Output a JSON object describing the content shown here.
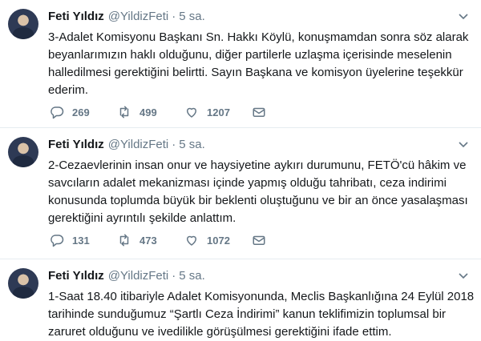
{
  "tweets": [
    {
      "name": "Feti Yıldız",
      "handle": "@YildizFeti",
      "separator": "·",
      "time": "5 sa.",
      "lines": [
        "3-Adalet Komisyonu Başkanı Sn. Hakkı Köylü, konuşmamdan sonra söz alarak",
        "beyanlarımızın haklı olduğunu, diğer partilerle uzlaşma içerisinde meselenin",
        "halledilmesi gerektiğini belirtti. Sayın Başkana ve komisyon üyelerine teşekkür",
        "ederim."
      ],
      "replies": "269",
      "retweets": "499",
      "likes": "1207"
    },
    {
      "name": "Feti Yıldız",
      "handle": "@YildizFeti",
      "separator": "·",
      "time": "5 sa.",
      "lines": [
        "2-Cezaevlerinin insan onur ve haysiyetine aykırı durumunu, FETÖ'cü hâkim ve",
        "savcıların adalet mekanizması içinde yapmış olduğu tahribatı, ceza indirimi",
        "konusunda toplumda büyük bir beklenti oluştuğunu ve bir an önce yasalaşması",
        "gerektiğini ayrıntılı şekilde anlattım."
      ],
      "replies": "131",
      "retweets": "473",
      "likes": "1072"
    },
    {
      "name": "Feti Yıldız",
      "handle": "@YildizFeti",
      "separator": "·",
      "time": "5 sa.",
      "lines": [
        "1-Saat 18.40 itibariyle Adalet Komisyonunda, Meclis Başkanlığına 24 Eylül 2018",
        "tarihinde sunduğumuz “Şartlı Ceza İndirimi” kanun teklifimizin toplumsal bir",
        "zaruret olduğunu ve ivedilikle görüşülmesi gerektiğini ifade ettim."
      ]
    }
  ],
  "icons": {
    "reply": "reply-icon",
    "retweet": "retweet-icon",
    "like": "heart-icon",
    "message": "envelope-icon",
    "menu": "chevron-down-icon"
  },
  "colors": {
    "text": "#14171a",
    "secondary": "#657786",
    "divider": "#e6ecf0"
  }
}
